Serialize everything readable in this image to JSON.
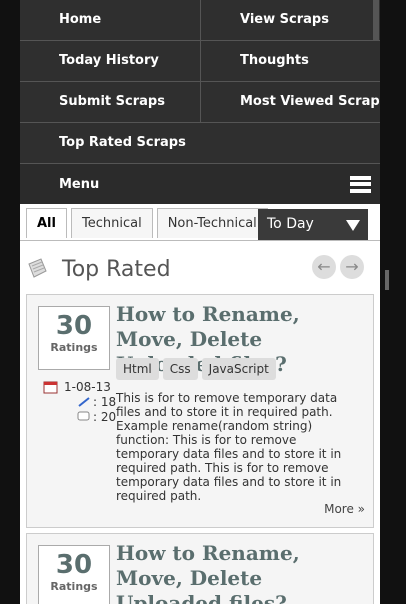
{
  "nav": {
    "home": "Home",
    "view_scraps": "View Scraps",
    "today_history": "Today History",
    "thoughts": "Thoughts",
    "submit_scraps": "Submit Scraps",
    "most_viewed": "Most Viewed Scraps",
    "top_rated": "Top Rated Scraps",
    "menu": "Menu"
  },
  "tabs": [
    "All",
    "Technical",
    "Non-Technical"
  ],
  "select": {
    "value": "To Day"
  },
  "section": {
    "title": "Top Rated"
  },
  "cards": [
    {
      "ratings": "30",
      "ratings_label": "Ratings",
      "title": "How to Rename, Move, Delete Uploaded files?",
      "tags": [
        "Html",
        "Css",
        "JavaScript"
      ],
      "date": "1-08-13",
      "views": ": 18",
      "comments": ": 20",
      "description": "This is for to remove temporary data files and to store it in required path. Example rename(random string) function: This is for to remove temporary data files and to store it in required path. This is for to remove temporary data files and to store it in required path.",
      "more": "More »"
    },
    {
      "ratings": "30",
      "ratings_label": "Ratings",
      "title": "How to Rename, Move, Delete Uploaded files?"
    }
  ]
}
